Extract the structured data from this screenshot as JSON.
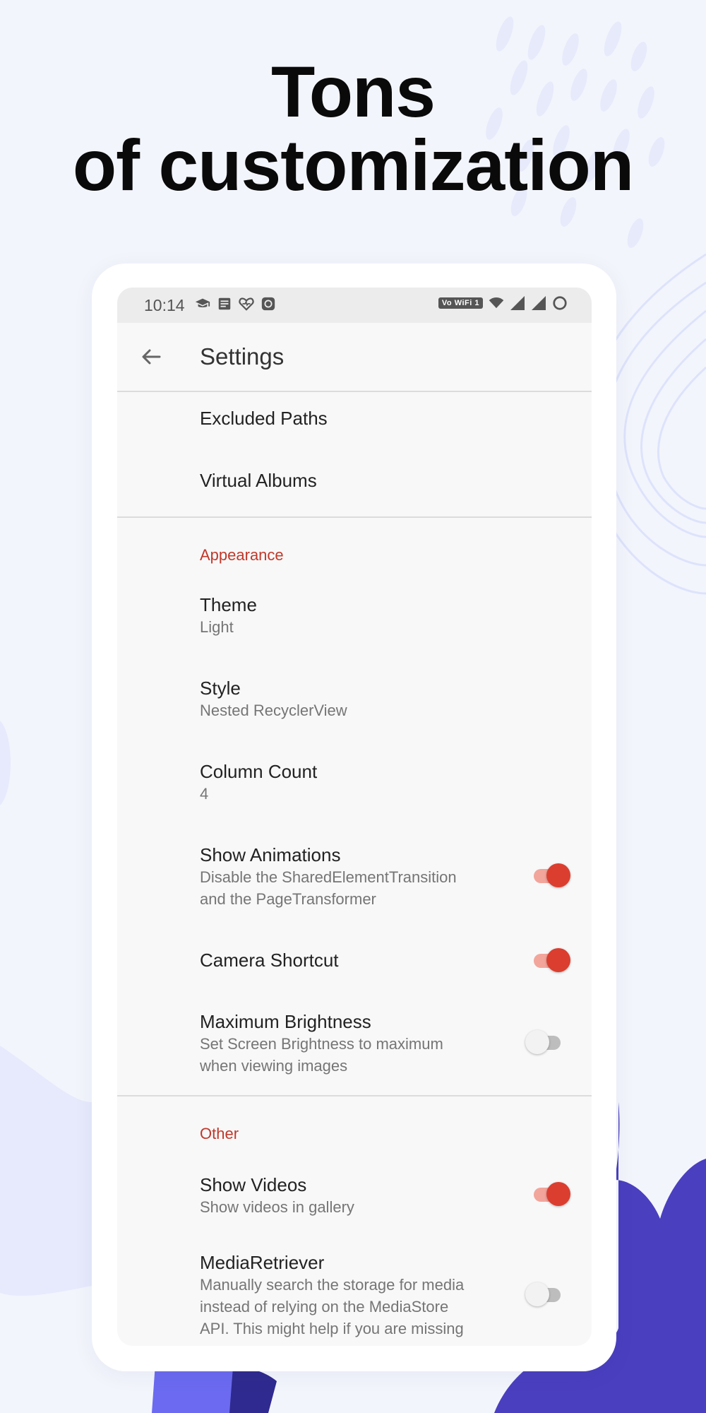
{
  "headline": {
    "line1": "Tons",
    "line2": "of customization"
  },
  "status_bar": {
    "time": "10:14",
    "left_icons": [
      "graduation-cap-icon",
      "document-icon",
      "heart-pulse-icon",
      "app-icon"
    ],
    "volte_label": "Vo WiFi 1",
    "right_icons": [
      "wifi-icon",
      "signal-icon",
      "signal-icon",
      "battery-ring-icon"
    ]
  },
  "toolbar": {
    "title": "Settings",
    "back_icon": "arrow-left-icon"
  },
  "top_items": [
    "Excluded Paths",
    "Virtual Albums"
  ],
  "appearance": {
    "header": "Appearance",
    "theme": {
      "title": "Theme",
      "summary": "Light"
    },
    "style": {
      "title": "Style",
      "summary": "Nested RecyclerView"
    },
    "column_count": {
      "title": "Column Count",
      "summary": "4"
    },
    "show_animations": {
      "title": "Show Animations",
      "summary1": "Disable the SharedElementTransition",
      "summary2": "and the PageTransformer",
      "checked": true
    },
    "camera_shortcut": {
      "title": "Camera Shortcut",
      "checked": true
    },
    "max_brightness": {
      "title": "Maximum Brightness",
      "summary1": "Set Screen Brightness to maximum",
      "summary2": "when viewing images",
      "checked": false
    }
  },
  "other": {
    "header": "Other",
    "show_videos": {
      "title": "Show Videos",
      "summary": "Show videos in gallery",
      "checked": true
    },
    "media_retriever": {
      "title": "MediaRetriever",
      "summary1": "Manually search the storage for media",
      "summary2": "instead of relying on the MediaStore",
      "summary3": "API. This might help if you are missing",
      "checked": false
    }
  },
  "colors": {
    "accent": "#db3e2f",
    "category_text": "#c0392b",
    "background": "#f3f5fc",
    "blob_dark": "#4a3fbf",
    "blob_light": "#6b6af0"
  }
}
